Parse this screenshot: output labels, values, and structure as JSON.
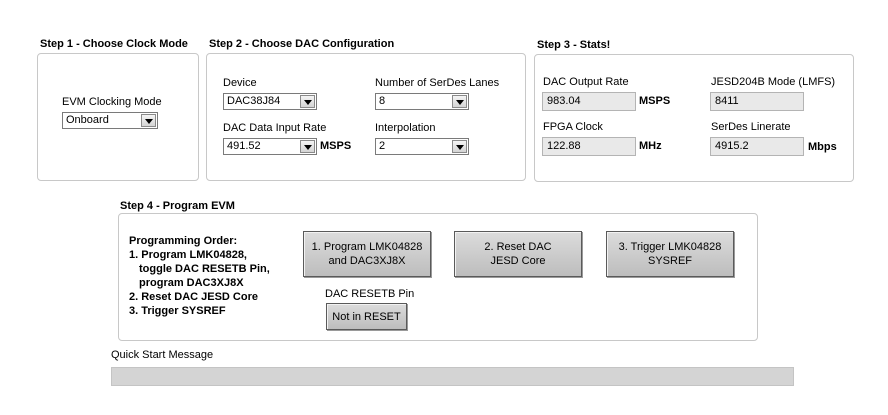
{
  "step1": {
    "title": "Step 1 - Choose Clock Mode",
    "clocking_label": "EVM Clocking Mode",
    "clocking_value": "Onboard"
  },
  "step2": {
    "title": "Step 2 - Choose DAC Configuration",
    "device_label": "Device",
    "device_value": "DAC38J84",
    "lanes_label": "Number of SerDes Lanes",
    "lanes_value": "8",
    "rate_label": "DAC Data Input Rate",
    "rate_value": "491.52",
    "rate_unit": "MSPS",
    "interp_label": "Interpolation",
    "interp_value": "2"
  },
  "step3": {
    "title": "Step 3 - Stats!",
    "dac_rate_label": "DAC Output Rate",
    "dac_rate_value": "983.04",
    "dac_rate_unit": "MSPS",
    "jesd_label": "JESD204B Mode (LMFS)",
    "jesd_value": "8411",
    "fpga_label": "FPGA Clock",
    "fpga_value": "122.88",
    "fpga_unit": "MHz",
    "serdes_label": "SerDes Linerate",
    "serdes_value": "4915.2",
    "serdes_unit": "Mbps"
  },
  "step4": {
    "title": "Step 4 - Program EVM",
    "order_lines": [
      "Programming Order:",
      "1. Program LMK04828,",
      "   toggle DAC RESETB Pin,",
      "   program DAC3XJ8X",
      "2. Reset DAC JESD Core",
      "3. Trigger SYSREF"
    ],
    "btn_program": "1. Program LMK04828\nand DAC3XJ8X",
    "btn_reset": "2. Reset DAC\nJESD Core",
    "btn_trigger": "3. Trigger LMK04828\nSYSREF",
    "resetb_label": "DAC RESETB Pin",
    "resetb_button": "Not in RESET"
  },
  "quick_start": {
    "label": "Quick Start Message",
    "message": ""
  }
}
